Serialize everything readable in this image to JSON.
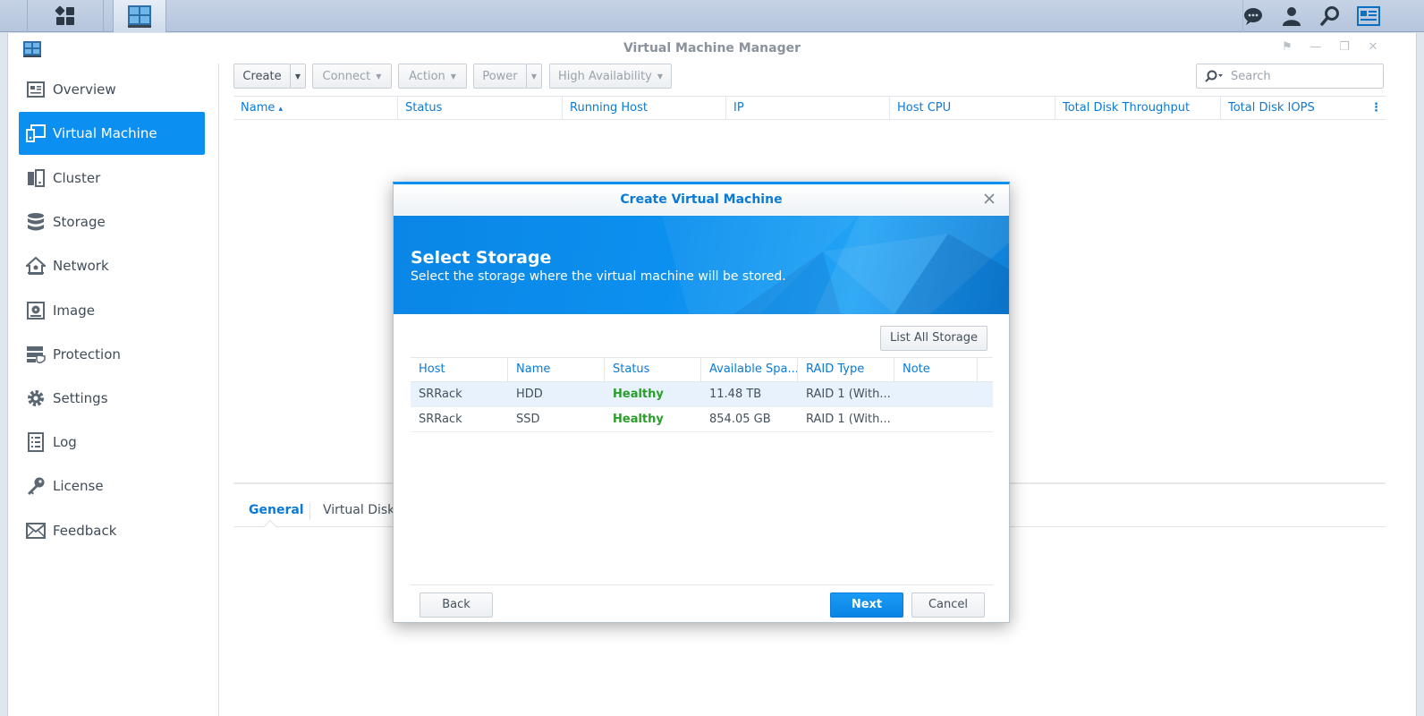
{
  "window": {
    "title": "Virtual Machine Manager"
  },
  "toolbar": {
    "create": "Create",
    "connect": "Connect",
    "action": "Action",
    "power": "Power",
    "high_availability": "High Availability",
    "search_placeholder": "Search"
  },
  "sidebar": {
    "items": [
      {
        "label": "Overview",
        "icon": "overview-icon"
      },
      {
        "label": "Virtual Machine",
        "icon": "virtual-machine-icon",
        "active": true
      },
      {
        "label": "Cluster",
        "icon": "cluster-icon"
      },
      {
        "label": "Storage",
        "icon": "storage-icon"
      },
      {
        "label": "Network",
        "icon": "network-icon"
      },
      {
        "label": "Image",
        "icon": "image-icon"
      },
      {
        "label": "Protection",
        "icon": "protection-icon"
      },
      {
        "label": "Settings",
        "icon": "gear-icon"
      },
      {
        "label": "Log",
        "icon": "log-icon"
      },
      {
        "label": "License",
        "icon": "key-icon"
      },
      {
        "label": "Feedback",
        "icon": "mail-icon"
      }
    ]
  },
  "grid": {
    "columns": [
      "Name",
      "Status",
      "Running Host",
      "IP",
      "Host CPU",
      "Total Disk Throughput",
      "Total Disk IOPS"
    ],
    "sort_indicator": "▴"
  },
  "detail_tabs": [
    "General",
    "Virtual Disk"
  ],
  "modal": {
    "title": "Create Virtual Machine",
    "banner_title": "Select Storage",
    "banner_subtitle": "Select the storage where the virtual machine will be stored.",
    "list_all_button": "List All Storage",
    "columns": [
      "Host",
      "Name",
      "Status",
      "Available Spa...",
      "RAID Type",
      "Note"
    ],
    "rows": [
      {
        "host": "SRRack",
        "name": "HDD",
        "status": "Healthy",
        "available": "11.48 TB",
        "raid": "RAID 1 (With...",
        "note": ""
      },
      {
        "host": "SRRack",
        "name": "SSD",
        "status": "Healthy",
        "available": "854.05 GB",
        "raid": "RAID 1 (With...",
        "note": ""
      }
    ],
    "back": "Back",
    "next": "Next",
    "cancel": "Cancel"
  },
  "colors": {
    "accent": "#0b8ff0",
    "healthy": "#2a9d2a",
    "link": "#0b7ad6"
  }
}
